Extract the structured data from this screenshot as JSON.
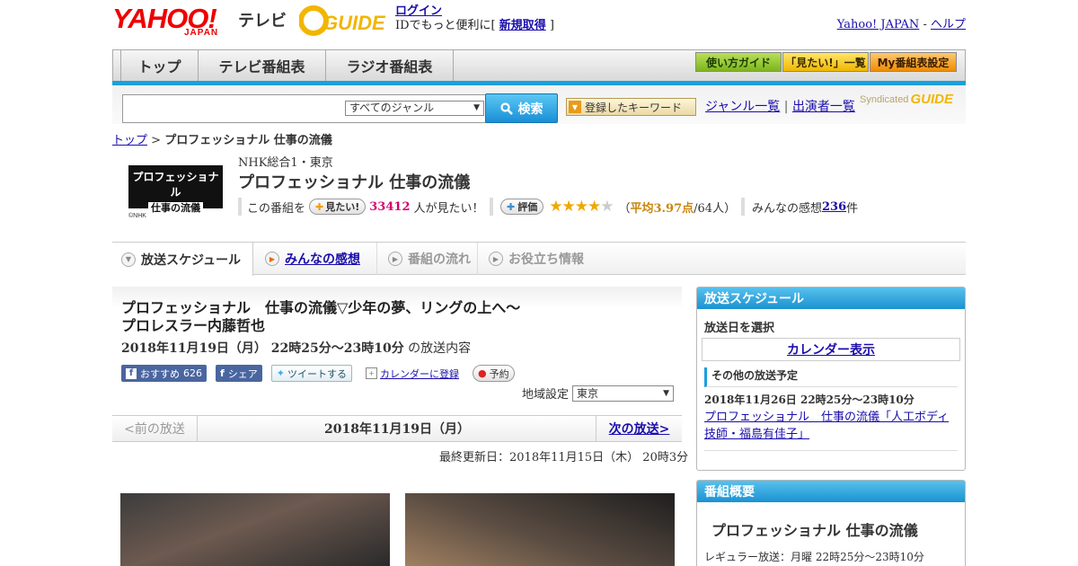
{
  "header": {
    "yahoo_logo": "YAHOO!",
    "yahoo_japan": "JAPAN",
    "tv_label": "テレビ",
    "gguide_logo": "GUIDE",
    "login_link": "ログイン",
    "login_text_prefix": "IDでもっと便利に[ ",
    "signup_link": "新規取得",
    "login_text_suffix": " ]",
    "yahoo_japan_link": "Yahoo! JAPAN",
    "separator": " - ",
    "help_link": "ヘルプ"
  },
  "nav": {
    "tabs": [
      {
        "label": "トップ"
      },
      {
        "label": "テレビ番組表"
      },
      {
        "label": "ラジオ番組表"
      }
    ],
    "buttons": [
      {
        "label": "使い方ガイド"
      },
      {
        "label": "「見たい!」一覧"
      },
      {
        "label": "My番組表設定"
      }
    ]
  },
  "search": {
    "genre_selected": "すべてのジャンル",
    "button_label": "検索",
    "keyword_button": "登録したキーワード",
    "genre_list_link": "ジャンル一覧",
    "link_separator": "|",
    "cast_list_link": "出演者一覧",
    "syndicated": "Syndicated"
  },
  "breadcrumb": {
    "top": "トップ",
    "separator": " > ",
    "current": "プロフェッショナル 仕事の流儀"
  },
  "program": {
    "logo_line1": "プロフェッショナル",
    "logo_line2": "仕事の流儀",
    "logo_credit": "©NHK",
    "channel": "NHK総合1・東京",
    "title": "プロフェッショナル 仕事の流儀",
    "want_prefix": "この番組を",
    "want_button": "見たい!",
    "want_count": "33412",
    "want_suffix": "人が見たい！",
    "rate_button": "評価",
    "rating_value": 3.97,
    "rating_open": "（",
    "rating_avg": "平均3.97点",
    "rating_count": "/64人）",
    "reviews_prefix": "みんなの感想 ",
    "reviews_count": "236",
    "reviews_suffix": "件"
  },
  "subtabs": [
    {
      "label": "放送スケジュール"
    },
    {
      "label": "みんなの感想"
    },
    {
      "label": "番組の流れ"
    },
    {
      "label": "お役立ち情報"
    }
  ],
  "episode": {
    "title_line1": "プロフェッショナル　仕事の流儀▽少年の夢、リングの上へ～",
    "title_line2": "プロレスラー内藤哲也",
    "date": "2018年11月19日（月） 22時25分～23時10分",
    "date_suffix": " の放送内容",
    "fb_recommend": "おすすめ",
    "fb_count": "626",
    "fb_share": "シェア",
    "tweet": "ツイートする",
    "calendar": "カレンダーに登録",
    "reserve": "予約",
    "region_label": "地域設定",
    "region_value": "東京"
  },
  "pager": {
    "prev": "<前の放送",
    "current": "2018年11月19日（月）",
    "next": "次の放送>"
  },
  "last_updated": "最終更新日：2018年11月15日（木） 20時3分",
  "sidebar": {
    "schedule_head": "放送スケジュール",
    "select_date": "放送日を選択",
    "calendar_link": "カレンダー表示",
    "other_head": "その他の放送予定",
    "other_date": "2018年11月26日 22時25分～23時10分",
    "other_title": "プロフェッショナル　仕事の流儀「人工ボディ技師・福島有佳子」",
    "summary_head": "番組概要",
    "summary_title": "プロフェッショナル 仕事の流儀",
    "summary_regular": "レギュラー放送：月曜 22時25分～23時10分"
  },
  "colors": {
    "accent_blue": "#1aa0dc",
    "yahoo_red": "#e00000",
    "want_count": "#d6006e",
    "rating": "#c8860a"
  }
}
